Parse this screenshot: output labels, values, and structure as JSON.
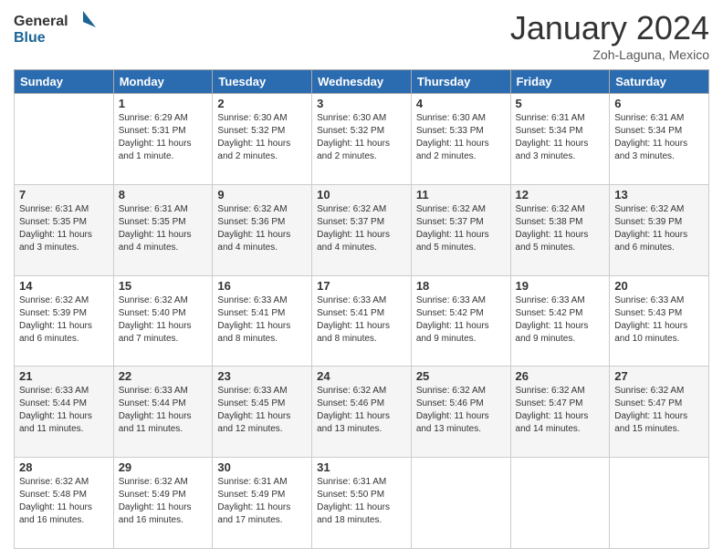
{
  "header": {
    "logo_line1": "General",
    "logo_line2": "Blue",
    "month_title": "January 2024",
    "location": "Zoh-Laguna, Mexico"
  },
  "days_of_week": [
    "Sunday",
    "Monday",
    "Tuesday",
    "Wednesday",
    "Thursday",
    "Friday",
    "Saturday"
  ],
  "weeks": [
    [
      {
        "num": "",
        "info": ""
      },
      {
        "num": "1",
        "info": "Sunrise: 6:29 AM\nSunset: 5:31 PM\nDaylight: 11 hours\nand 1 minute."
      },
      {
        "num": "2",
        "info": "Sunrise: 6:30 AM\nSunset: 5:32 PM\nDaylight: 11 hours\nand 2 minutes."
      },
      {
        "num": "3",
        "info": "Sunrise: 6:30 AM\nSunset: 5:32 PM\nDaylight: 11 hours\nand 2 minutes."
      },
      {
        "num": "4",
        "info": "Sunrise: 6:30 AM\nSunset: 5:33 PM\nDaylight: 11 hours\nand 2 minutes."
      },
      {
        "num": "5",
        "info": "Sunrise: 6:31 AM\nSunset: 5:34 PM\nDaylight: 11 hours\nand 3 minutes."
      },
      {
        "num": "6",
        "info": "Sunrise: 6:31 AM\nSunset: 5:34 PM\nDaylight: 11 hours\nand 3 minutes."
      }
    ],
    [
      {
        "num": "7",
        "info": "Sunrise: 6:31 AM\nSunset: 5:35 PM\nDaylight: 11 hours\nand 3 minutes."
      },
      {
        "num": "8",
        "info": "Sunrise: 6:31 AM\nSunset: 5:35 PM\nDaylight: 11 hours\nand 4 minutes."
      },
      {
        "num": "9",
        "info": "Sunrise: 6:32 AM\nSunset: 5:36 PM\nDaylight: 11 hours\nand 4 minutes."
      },
      {
        "num": "10",
        "info": "Sunrise: 6:32 AM\nSunset: 5:37 PM\nDaylight: 11 hours\nand 4 minutes."
      },
      {
        "num": "11",
        "info": "Sunrise: 6:32 AM\nSunset: 5:37 PM\nDaylight: 11 hours\nand 5 minutes."
      },
      {
        "num": "12",
        "info": "Sunrise: 6:32 AM\nSunset: 5:38 PM\nDaylight: 11 hours\nand 5 minutes."
      },
      {
        "num": "13",
        "info": "Sunrise: 6:32 AM\nSunset: 5:39 PM\nDaylight: 11 hours\nand 6 minutes."
      }
    ],
    [
      {
        "num": "14",
        "info": "Sunrise: 6:32 AM\nSunset: 5:39 PM\nDaylight: 11 hours\nand 6 minutes."
      },
      {
        "num": "15",
        "info": "Sunrise: 6:32 AM\nSunset: 5:40 PM\nDaylight: 11 hours\nand 7 minutes."
      },
      {
        "num": "16",
        "info": "Sunrise: 6:33 AM\nSunset: 5:41 PM\nDaylight: 11 hours\nand 8 minutes."
      },
      {
        "num": "17",
        "info": "Sunrise: 6:33 AM\nSunset: 5:41 PM\nDaylight: 11 hours\nand 8 minutes."
      },
      {
        "num": "18",
        "info": "Sunrise: 6:33 AM\nSunset: 5:42 PM\nDaylight: 11 hours\nand 9 minutes."
      },
      {
        "num": "19",
        "info": "Sunrise: 6:33 AM\nSunset: 5:42 PM\nDaylight: 11 hours\nand 9 minutes."
      },
      {
        "num": "20",
        "info": "Sunrise: 6:33 AM\nSunset: 5:43 PM\nDaylight: 11 hours\nand 10 minutes."
      }
    ],
    [
      {
        "num": "21",
        "info": "Sunrise: 6:33 AM\nSunset: 5:44 PM\nDaylight: 11 hours\nand 11 minutes."
      },
      {
        "num": "22",
        "info": "Sunrise: 6:33 AM\nSunset: 5:44 PM\nDaylight: 11 hours\nand 11 minutes."
      },
      {
        "num": "23",
        "info": "Sunrise: 6:33 AM\nSunset: 5:45 PM\nDaylight: 11 hours\nand 12 minutes."
      },
      {
        "num": "24",
        "info": "Sunrise: 6:32 AM\nSunset: 5:46 PM\nDaylight: 11 hours\nand 13 minutes."
      },
      {
        "num": "25",
        "info": "Sunrise: 6:32 AM\nSunset: 5:46 PM\nDaylight: 11 hours\nand 13 minutes."
      },
      {
        "num": "26",
        "info": "Sunrise: 6:32 AM\nSunset: 5:47 PM\nDaylight: 11 hours\nand 14 minutes."
      },
      {
        "num": "27",
        "info": "Sunrise: 6:32 AM\nSunset: 5:47 PM\nDaylight: 11 hours\nand 15 minutes."
      }
    ],
    [
      {
        "num": "28",
        "info": "Sunrise: 6:32 AM\nSunset: 5:48 PM\nDaylight: 11 hours\nand 16 minutes."
      },
      {
        "num": "29",
        "info": "Sunrise: 6:32 AM\nSunset: 5:49 PM\nDaylight: 11 hours\nand 16 minutes."
      },
      {
        "num": "30",
        "info": "Sunrise: 6:31 AM\nSunset: 5:49 PM\nDaylight: 11 hours\nand 17 minutes."
      },
      {
        "num": "31",
        "info": "Sunrise: 6:31 AM\nSunset: 5:50 PM\nDaylight: 11 hours\nand 18 minutes."
      },
      {
        "num": "",
        "info": ""
      },
      {
        "num": "",
        "info": ""
      },
      {
        "num": "",
        "info": ""
      }
    ]
  ]
}
